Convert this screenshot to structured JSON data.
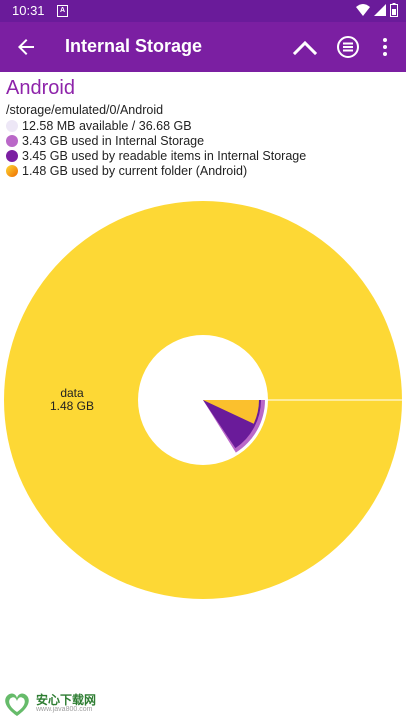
{
  "status_bar": {
    "time": "10:31",
    "notification_glyph": "A",
    "icons": [
      "wifi-icon",
      "signal-icon",
      "battery-icon"
    ]
  },
  "app_bar": {
    "title": "Internal Storage",
    "color": "#7b1fa2",
    "icons": [
      "back-arrow-icon",
      "chevron-up-icon",
      "list-menu-icon",
      "overflow-menu-icon"
    ]
  },
  "folder": {
    "name": "Android",
    "path": "/storage/emulated/0/Android"
  },
  "legend": [
    {
      "text": "12.58 MB available / 36.68 GB",
      "color": "#ede7f6"
    },
    {
      "text": "3.43 GB used in Internal Storage",
      "color": "#ba68c8"
    },
    {
      "text": "3.45 GB used by readable items in Internal Storage",
      "color": "#7b1fa2"
    },
    {
      "text": "1.48 GB used by current folder (Android)",
      "color": "#fdd835"
    }
  ],
  "chart_data": {
    "type": "pie",
    "style": "sunburst",
    "slices": [
      {
        "label": "data",
        "value_text": "1.48 GB",
        "value": 1.48,
        "unit": "GB",
        "color": "#fdd835"
      }
    ],
    "inner_ring": {
      "used_internal_gb": 3.43,
      "used_readable_gb": 3.45,
      "current_folder_gb": 1.48,
      "colors": {
        "used": "#ba68c8",
        "readable": "#6a1b9a",
        "folder": "#fbc02d"
      }
    }
  },
  "watermark": {
    "main": "安心下载网",
    "sub": "www.java800.com"
  }
}
